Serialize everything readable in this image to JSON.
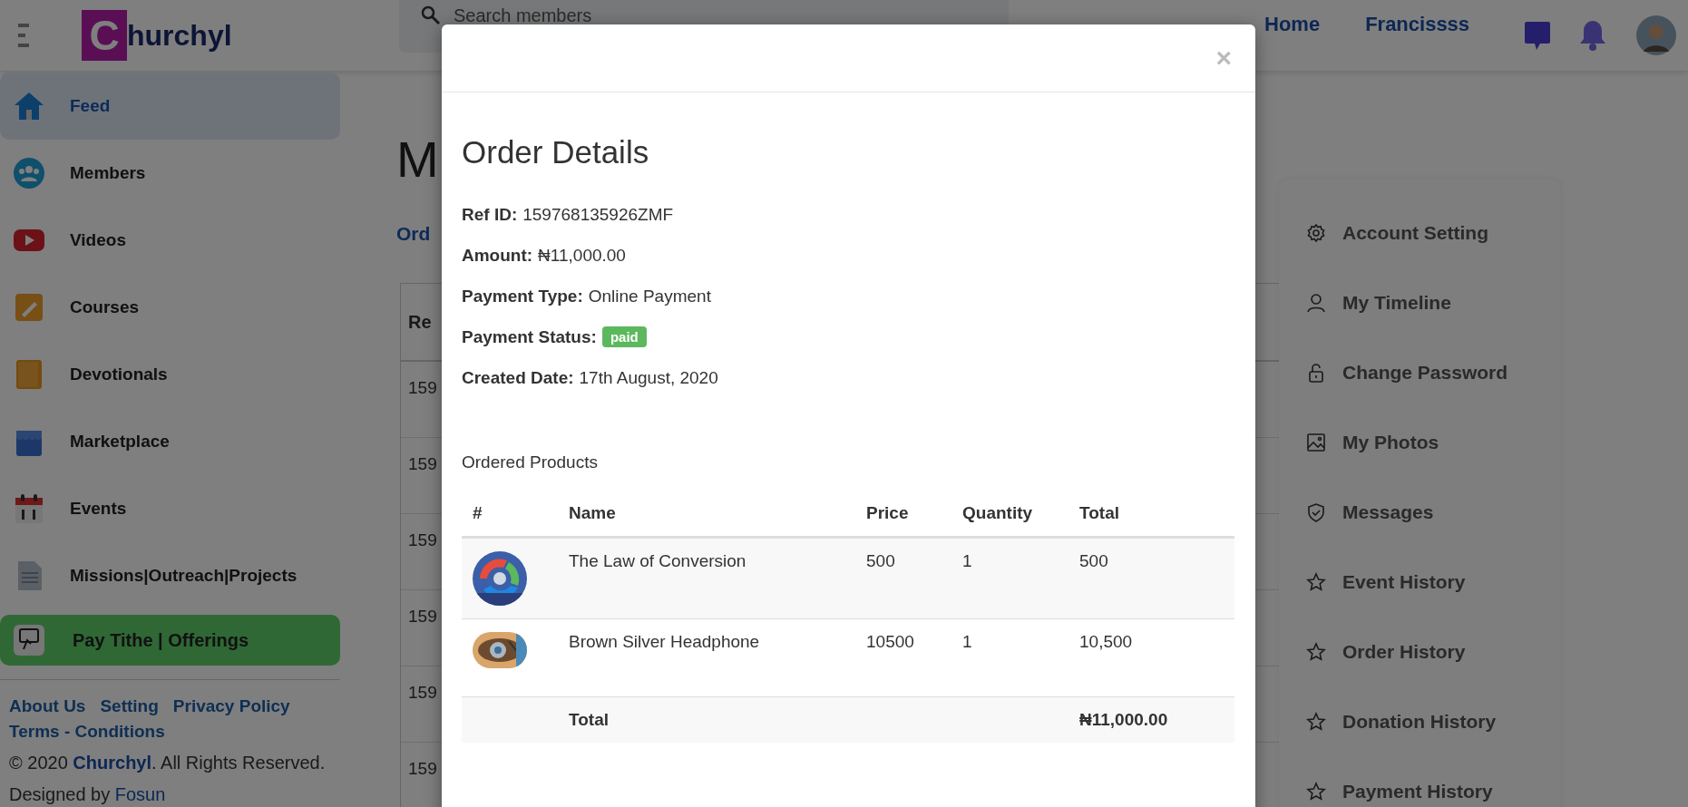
{
  "header": {
    "logo_letter": "C",
    "logo_rest": "hurchyl",
    "search": {
      "placeholder": "Search members"
    },
    "nav": [
      "Home",
      "Francissss"
    ]
  },
  "sidebar": {
    "items": [
      {
        "label": "Feed",
        "selected": true,
        "kind": "link"
      },
      {
        "label": "Members",
        "selected": false,
        "kind": "link"
      },
      {
        "label": "Videos",
        "selected": false,
        "kind": "link"
      },
      {
        "label": "Courses",
        "selected": false,
        "kind": "link"
      },
      {
        "label": "Devotionals",
        "selected": false,
        "kind": "link"
      },
      {
        "label": "Marketplace",
        "selected": false,
        "kind": "link"
      },
      {
        "label": "Events",
        "selected": false,
        "kind": "link"
      },
      {
        "label": "Missions|Outreach|Projects",
        "selected": false,
        "kind": "link"
      },
      {
        "label": "Pay Tithe | Offerings",
        "selected": false,
        "kind": "button"
      }
    ],
    "footer_links": [
      "About Us",
      "Setting",
      "Privacy Policy",
      "Terms - Conditions"
    ],
    "copyright": {
      "prefix": "© 2020",
      "brand": "Churchyl",
      "suffix": ". All Rights Reserved."
    },
    "designed_by": {
      "prefix": "Designed by",
      "brand": "Fosun"
    }
  },
  "main": {
    "title": "M",
    "link": "Ord",
    "table": {
      "column_1": "Re",
      "rows": [
        "159",
        "159",
        "159",
        "159",
        "159",
        "159"
      ]
    }
  },
  "account_menu": {
    "items": [
      "Account Setting",
      "My Timeline",
      "Change Password",
      "My Photos",
      "Messages",
      "Event History",
      "Order History",
      "Donation History",
      "Payment History"
    ]
  },
  "modal": {
    "close": "×",
    "title": "Order Details",
    "fields": [
      {
        "label": "Ref ID:",
        "value": "159768135926ZMF",
        "kind": "text"
      },
      {
        "label": "Amount:",
        "value": "₦11,000.00",
        "kind": "text"
      },
      {
        "label": "Payment Type:",
        "value": "Online Payment",
        "kind": "text"
      },
      {
        "label": "Payment Status:",
        "value": "paid",
        "kind": "badge"
      },
      {
        "label": "Created Date:",
        "value": "17th August, 2020",
        "kind": "text"
      }
    ],
    "products_heading": "Ordered Products",
    "table": {
      "columns": [
        "#",
        "Name",
        "Price",
        "Quantity",
        "Total"
      ],
      "rows": [
        {
          "name": "The Law of Conversion",
          "price": "500",
          "quantity": "1",
          "total": "500"
        },
        {
          "name": "Brown Silver Headphone",
          "price": "10500",
          "quantity": "1",
          "total": "10,500"
        }
      ],
      "footer": {
        "label": "Total",
        "value": "₦11,000.00"
      }
    }
  }
}
